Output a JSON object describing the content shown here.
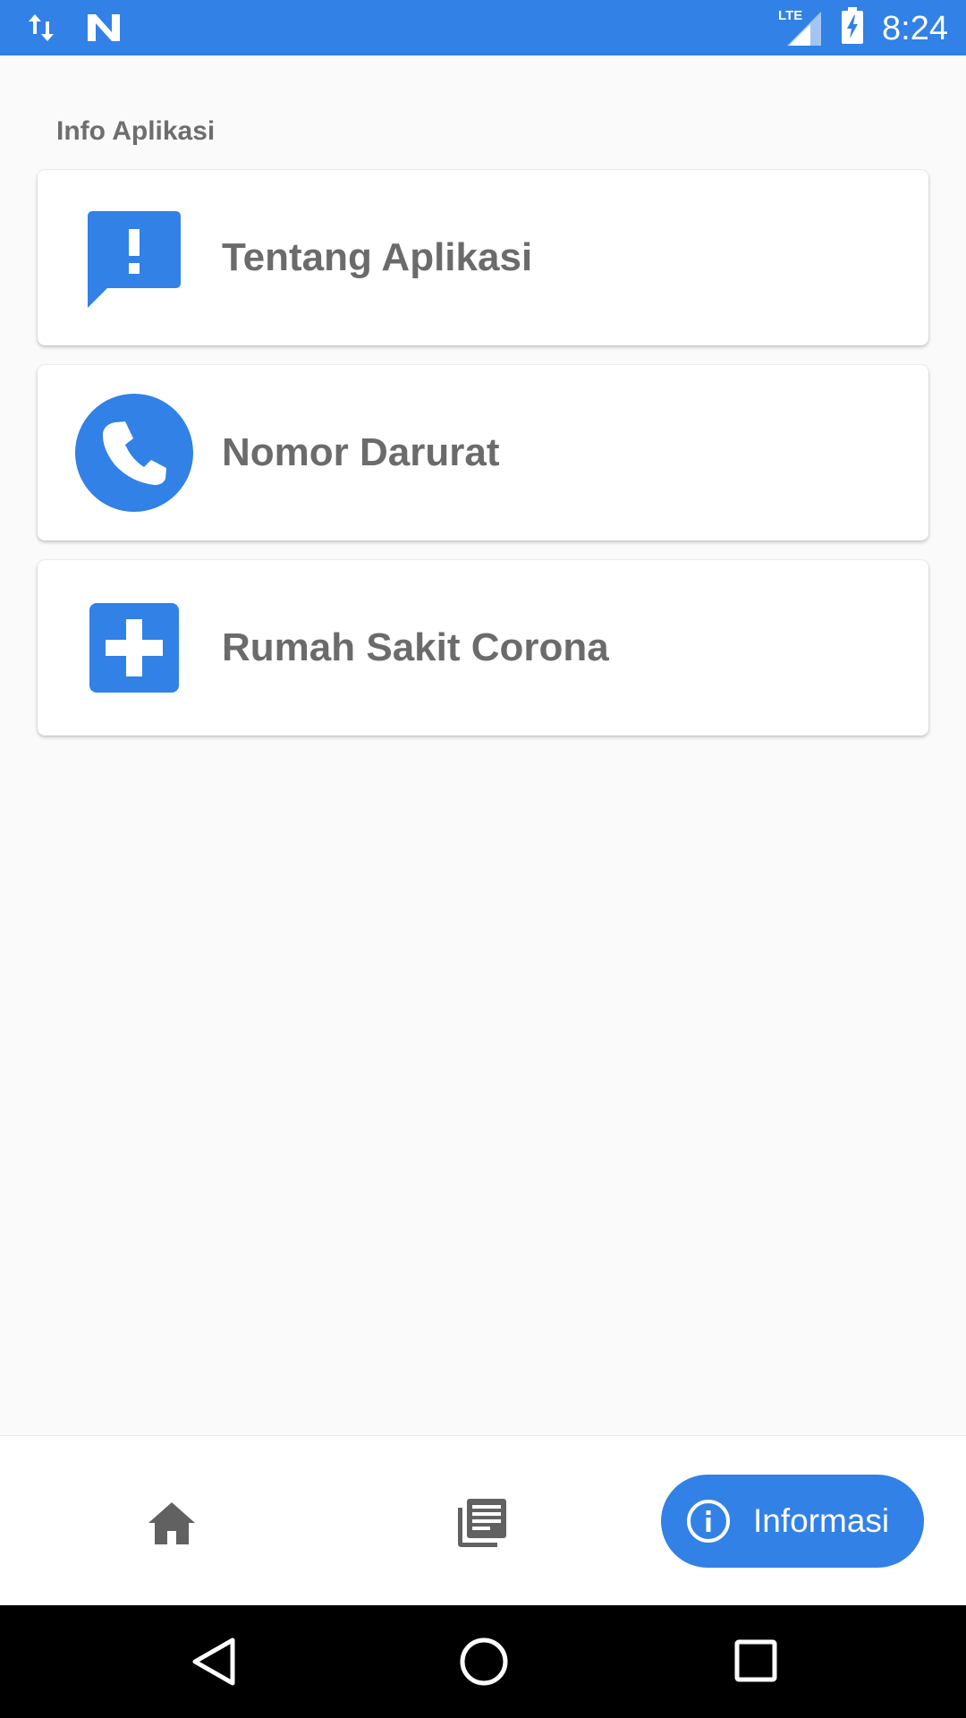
{
  "status_bar": {
    "time": "8:24",
    "network": "LTE",
    "icons": [
      "data-transfer-icon",
      "n-notification-icon",
      "lte-signal-icon",
      "battery-charging-icon"
    ]
  },
  "section": {
    "title": "Info Aplikasi"
  },
  "cards": [
    {
      "label": "Tentang Aplikasi",
      "icon": "feedback-icon"
    },
    {
      "label": "Nomor Darurat",
      "icon": "phone-icon"
    },
    {
      "label": "Rumah Sakit Corona",
      "icon": "hospital-icon"
    }
  ],
  "bottom_nav": {
    "items": [
      {
        "icon": "home-icon"
      },
      {
        "icon": "news-icon"
      },
      {
        "icon": "info-icon",
        "label": "Informasi",
        "selected": true
      }
    ]
  },
  "colors": {
    "accent": "#3181e6",
    "text_gray": "#6b6b6b",
    "background": "#fafafa"
  }
}
